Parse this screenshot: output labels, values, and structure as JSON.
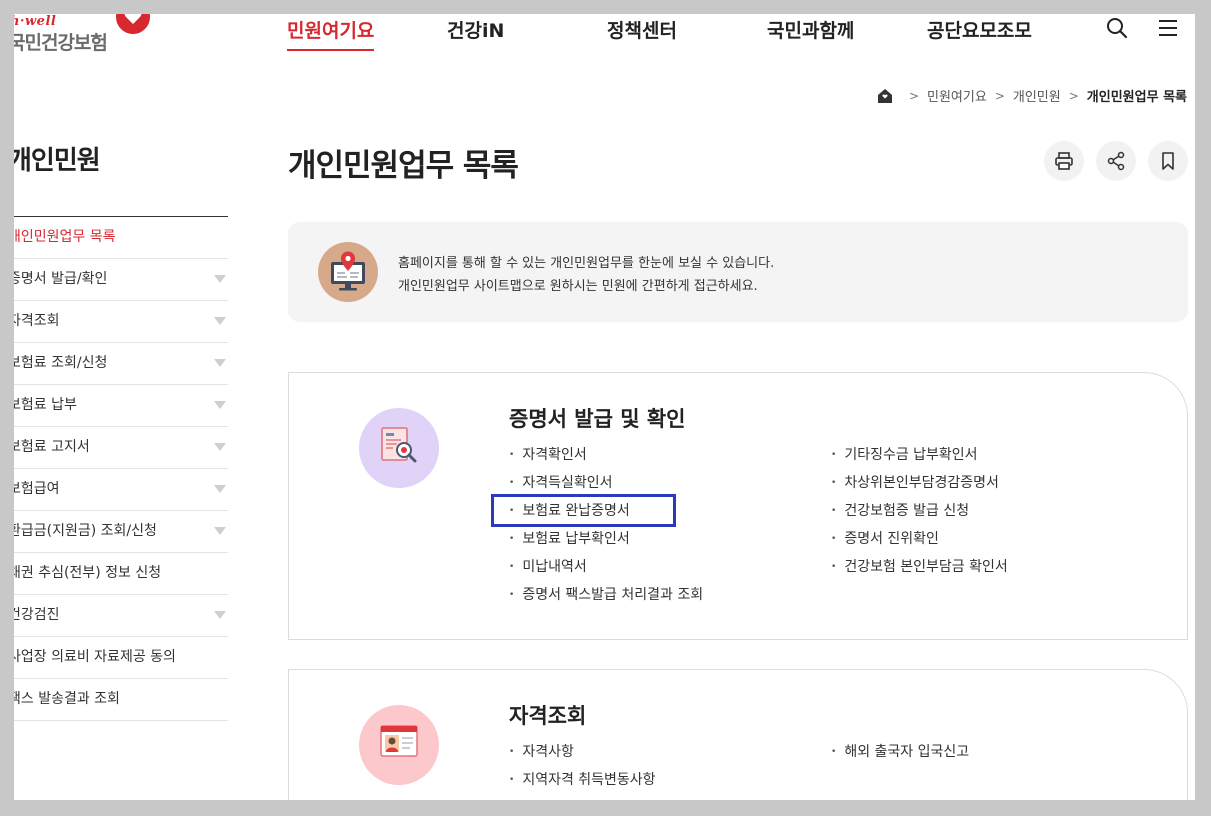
{
  "header": {
    "logo_brand": "h·well",
    "logo_name": "국민건강보험",
    "nav": [
      "민원여기요",
      "건강iN",
      "정책센터",
      "국민과함께",
      "공단요모조모"
    ],
    "active_nav": "민원여기요",
    "icons": [
      "search-icon",
      "menu-icon"
    ]
  },
  "breadcrumb": {
    "items": [
      "민원여기요",
      "개인민원",
      "개인민원업무 목록"
    ]
  },
  "sidebar": {
    "title": "개인민원",
    "items": [
      {
        "label": "개인민원업무 목록",
        "active": true,
        "expandable": false
      },
      {
        "label": "증명서 발급/확인",
        "active": false,
        "expandable": true
      },
      {
        "label": "자격조회",
        "active": false,
        "expandable": true
      },
      {
        "label": "보험료 조회/신청",
        "active": false,
        "expandable": true
      },
      {
        "label": "보험료 납부",
        "active": false,
        "expandable": true
      },
      {
        "label": "보험료 고지서",
        "active": false,
        "expandable": true
      },
      {
        "label": "보험급여",
        "active": false,
        "expandable": true
      },
      {
        "label": "환급금(지원금) 조회/신청",
        "active": false,
        "expandable": true
      },
      {
        "label": "채권 추심(전부) 정보 신청",
        "active": false,
        "expandable": false
      },
      {
        "label": "건강검진",
        "active": false,
        "expandable": true
      },
      {
        "label": "사업장 의료비 자료제공 동의",
        "active": false,
        "expandable": false
      },
      {
        "label": "팩스 발송결과 조회",
        "active": false,
        "expandable": false
      }
    ]
  },
  "main": {
    "title": "개인민원업무 목록",
    "tools": [
      "print-icon",
      "share-icon",
      "bookmark-icon"
    ],
    "info_line1": "홈페이지를 통해 할 수 있는 개인민원업무를 한눈에 보실 수 있습니다.",
    "info_line2": "개인민원업무 사이트맵으로 원하시는 민원에 간편하게 접근하세요.",
    "sections": [
      {
        "title": "증명서 발급 및 확인",
        "left": [
          "자격확인서",
          "자격득실확인서",
          "보험료 완납증명서",
          "보험료 납부확인서",
          "미납내역서",
          "증명서 팩스발급 처리결과 조회"
        ],
        "right": [
          "기타징수금 납부확인서",
          "차상위본인부담경감증명서",
          "건강보험증 발급 신청",
          "증명서 진위확인",
          "건강보험 본인부담금 확인서"
        ]
      },
      {
        "title": "자격조회",
        "left": [
          "자격사항",
          "지역자격 취득변동사항"
        ],
        "right": [
          "해외 출국자 입국신고"
        ]
      }
    ]
  },
  "colors": {
    "brand_red": "#d7282f",
    "highlight_blue": "#2b3ab8",
    "section1_icon_bg": "#e0d3f7",
    "section2_icon_bg": "#fcc8cc"
  }
}
